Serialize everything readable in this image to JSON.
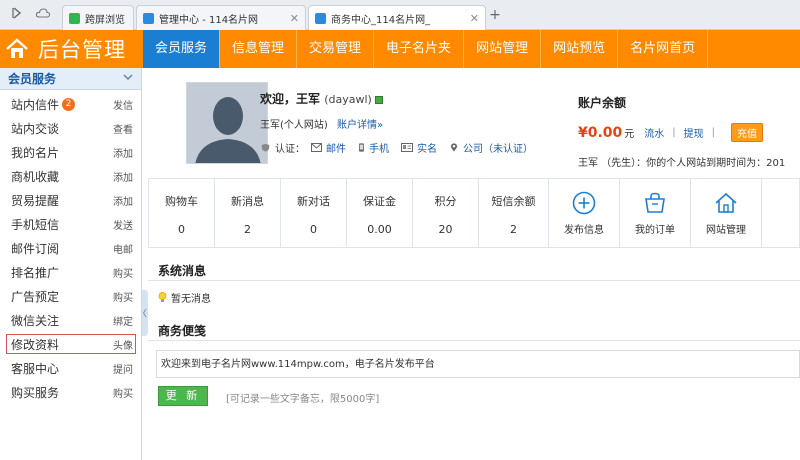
{
  "browser": {
    "tabs": [
      {
        "label": "跨屏浏览",
        "active": false,
        "color": "#2db84d"
      },
      {
        "label": "管理中心 - 114名片网",
        "active": false,
        "color": "#2a8be0"
      },
      {
        "label": "商务中心_114名片网_",
        "active": true,
        "color": "#2a8be0"
      }
    ],
    "icons": {
      "forward": "chevron-right-icon",
      "cloud": "cloud-icon",
      "close": "close-icon",
      "new_tab": "plus-icon"
    }
  },
  "header": {
    "logo_text": "后台管理",
    "logo_icon": "house-icon",
    "nav": [
      "会员服务",
      "信息管理",
      "交易管理",
      "电子名片夹",
      "网站管理",
      "网站预览",
      "名片网首页"
    ],
    "active_index": 0,
    "colors": {
      "bar": "#ff8a00",
      "active": "#1a7fd3"
    }
  },
  "sidebar": {
    "title": "会员服务",
    "items": [
      {
        "label": "站内信件",
        "action": "发信",
        "badge": "2"
      },
      {
        "label": "站内交谈",
        "action": "查看"
      },
      {
        "label": "我的名片",
        "action": "添加"
      },
      {
        "label": "商机收藏",
        "action": "添加"
      },
      {
        "label": "贸易提醒",
        "action": "添加"
      },
      {
        "label": "手机短信",
        "action": "发送"
      },
      {
        "label": "邮件订阅",
        "action": "电邮"
      },
      {
        "label": "排名推广",
        "action": "购买"
      },
      {
        "label": "广告预定",
        "action": "购买"
      },
      {
        "label": "微信关注",
        "action": "绑定"
      },
      {
        "label": "修改资料",
        "action": "头像",
        "selected": true
      },
      {
        "label": "客服中心",
        "action": "提问"
      },
      {
        "label": "购买服务",
        "action": "购买"
      }
    ]
  },
  "profile": {
    "welcome": "欢迎，王军",
    "username": "(dayawl)",
    "site_type": "王军(个人网站)",
    "detail_link": "账户详情»",
    "cert_label": "认证：",
    "certs": [
      "邮件",
      "手机",
      "实名",
      "公司（未认证）"
    ]
  },
  "account": {
    "title": "账户余额",
    "amount": "¥0.00",
    "unit": "元",
    "links": [
      "流水",
      "提现"
    ],
    "charge_button": "充值",
    "note": "王军 （先生）：你的个人网站到期时间为：201"
  },
  "stats": [
    {
      "label": "购物车",
      "value": "0"
    },
    {
      "label": "新消息",
      "value": "2"
    },
    {
      "label": "新对话",
      "value": "0"
    },
    {
      "label": "保证金",
      "value": "0.00"
    },
    {
      "label": "积分",
      "value": "20"
    },
    {
      "label": "短信余额",
      "value": "2"
    }
  ],
  "quick_actions": [
    {
      "label": "发布信息",
      "icon": "plus-circle-icon"
    },
    {
      "label": "我的订单",
      "icon": "bag-icon"
    },
    {
      "label": "网站管理",
      "icon": "home-icon"
    }
  ],
  "system_messages": {
    "title": "系统消息",
    "empty_text": "暂无消息"
  },
  "memo": {
    "title": "商务便笺",
    "content": "欢迎来到电子名片网www.114mpw.com，电子名片发布平台",
    "update_button": "更 新",
    "hint": "[可记录一些文字备忘，限5000字]"
  }
}
